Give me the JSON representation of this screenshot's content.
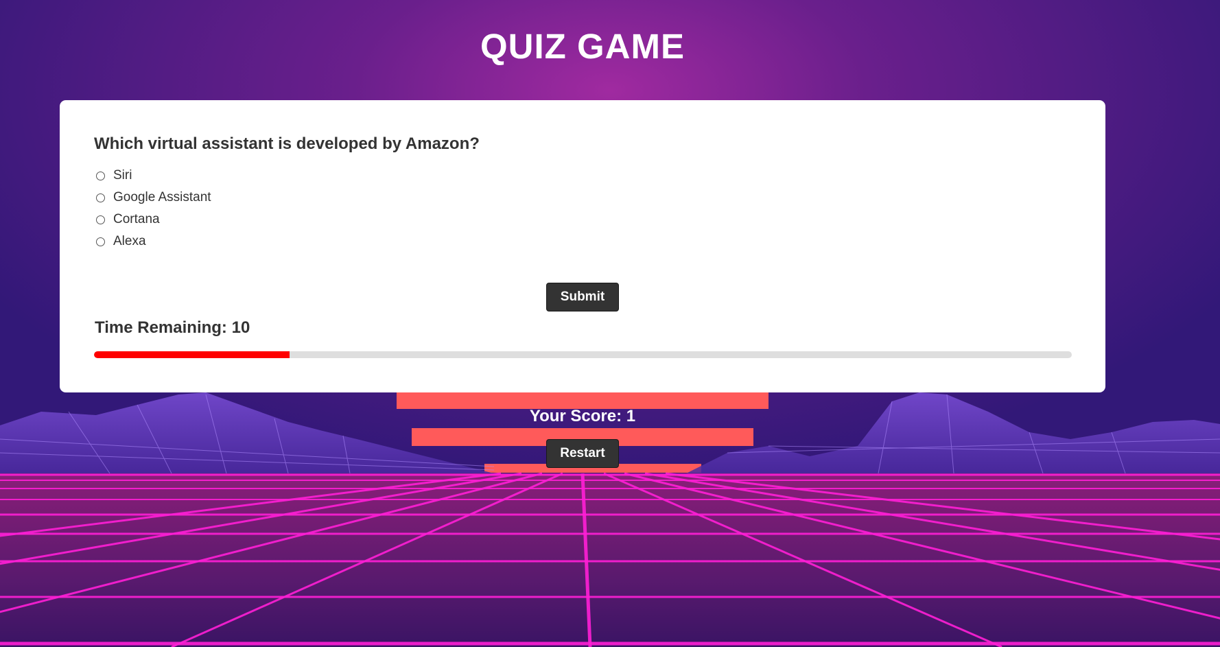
{
  "header": {
    "title": "QUIZ GAME"
  },
  "quiz": {
    "question": "Which virtual assistant is developed by Amazon?",
    "options": [
      "Siri",
      "Google Assistant",
      "Cortana",
      "Alexa"
    ],
    "selected": null,
    "submit_label": "Submit",
    "timer_text": "Time Remaining: 10",
    "time_progress_fraction": 0.2
  },
  "footer": {
    "score_text": "Your Score: 1",
    "restart_label": "Restart"
  },
  "colors": {
    "progress_fill": "#ff0000",
    "progress_track": "#dedede",
    "button_bg": "#333333",
    "card_bg": "#ffffff",
    "neon_grid": "#ff1fd6",
    "sky": "#3a1a7a"
  },
  "icons": {
    "radio": "radio-circle-icon"
  }
}
